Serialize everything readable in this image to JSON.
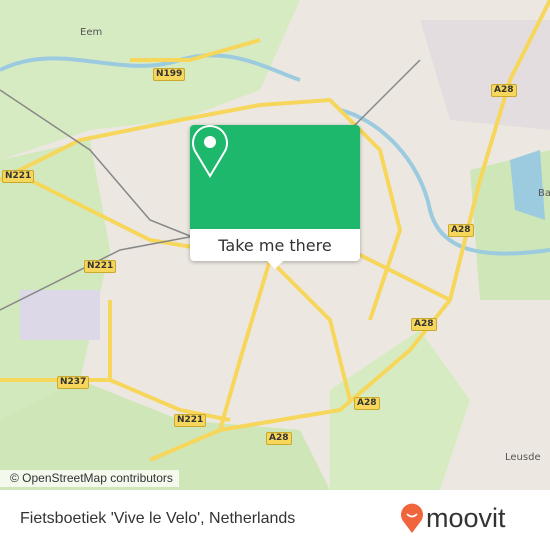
{
  "map": {
    "attribution": "© OpenStreetMap contributors",
    "labels": {
      "eem": "Eem",
      "n199": "N199",
      "a28_1": "A28",
      "a28_2": "A28",
      "a28_3": "A28",
      "a28_4": "A28",
      "a28_5": "A28",
      "n221_1": "N221",
      "n221_2": "N221",
      "n221_3": "N221",
      "n237": "N237",
      "ba": "Ba",
      "leusden": "Leusde"
    }
  },
  "popup": {
    "button_label": "Take me there",
    "icon": "location-pin-icon",
    "color": "#1db86b"
  },
  "footer": {
    "place_name": "Fietsboetiek 'Vive le Velo', Netherlands",
    "brand": "moovit",
    "brand_color": "#f0653b"
  }
}
